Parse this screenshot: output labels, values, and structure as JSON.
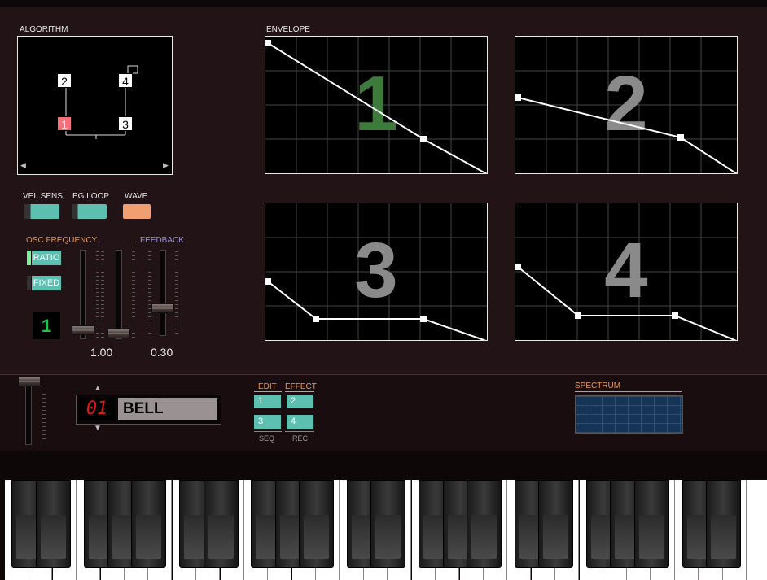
{
  "algorithm": {
    "label": "ALGORITHM",
    "nodes": [
      "1",
      "2",
      "3",
      "4"
    ],
    "nav_left": "◀",
    "nav_right": "▶"
  },
  "envelope": {
    "label": "ENVELOPE",
    "panels": [
      {
        "number": "1",
        "color": "#3e7a3c"
      },
      {
        "number": "2",
        "color": "#8a8a8a"
      },
      {
        "number": "3",
        "color": "#8a8a8a"
      },
      {
        "number": "4",
        "color": "#8a8a8a"
      }
    ]
  },
  "toggles": {
    "vel_sens": "VEL.SENS",
    "eg_loop": "EG.LOOP",
    "wave": "WAVE"
  },
  "osc": {
    "label": "OSC FREQUENCY",
    "feedback_label": "FEEDBACK",
    "ratio": "RATIO",
    "fixed": "FIXED",
    "operator": "1",
    "freq_value": "1.00",
    "feedback_value": "0.30"
  },
  "preset": {
    "up": "▲",
    "down": "▼",
    "number": "01",
    "name": "BELL"
  },
  "modes": {
    "edit": "EDIT",
    "effect": "EFFECT",
    "seq": "SEQ",
    "rec": "REC",
    "buttons": [
      "1",
      "2",
      "3",
      "4"
    ]
  },
  "spectrum": {
    "label": "SPECTRUM"
  },
  "colors": {
    "accent_teal": "#5cbfb0",
    "wave_orange": "#f0a070",
    "alg_active_red": "#f2707a",
    "osc_orange": "#e49a5a",
    "feedback_purple": "#9b8fd6"
  }
}
